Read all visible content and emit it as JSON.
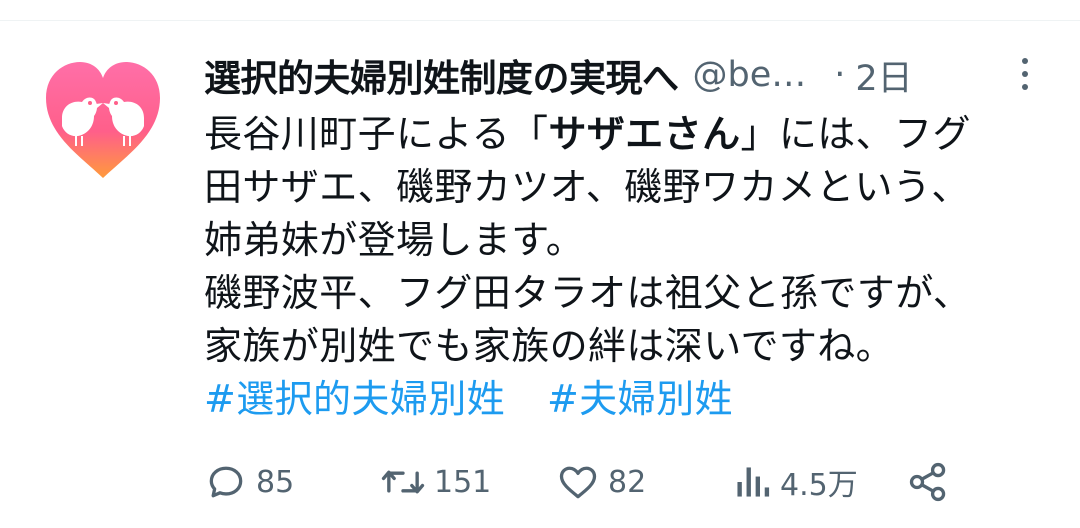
{
  "tweet": {
    "display_name": "選択的夫婦別姓制度の実現へ",
    "handle": "@be…",
    "separator": "·",
    "time": "2日",
    "text": {
      "line1_pre": "長谷川町子による「",
      "line1_bold": "サザエさん",
      "line1_post": "」には、フグ",
      "line2": "田サザエ、磯野カツオ、磯野ワカメという、",
      "line3": "姉弟妹が登場します。",
      "line4": "磯野波平、フグ田タラオは祖父と孫ですが、",
      "line5": "家族が別姓でも家族の絆は深いですね。"
    },
    "hashtags": [
      "#選択的夫婦別姓",
      "#夫婦別姓"
    ]
  },
  "actions": {
    "reply_count": "85",
    "retweet_count": "151",
    "like_count": "82",
    "views_count": "4.5万"
  },
  "icons": {
    "avatar": "heart-with-two-birds",
    "more": "more-vertical-icon",
    "reply": "reply-icon",
    "retweet": "retweet-icon",
    "like": "like-icon",
    "views": "views-icon",
    "share": "share-icon"
  },
  "colors": {
    "text": "#0f1419",
    "secondary": "#536471",
    "link": "#1d9bf0",
    "avatar_heart_top": "#ff6fa8",
    "avatar_heart_bottom": "#ff9a3c"
  }
}
